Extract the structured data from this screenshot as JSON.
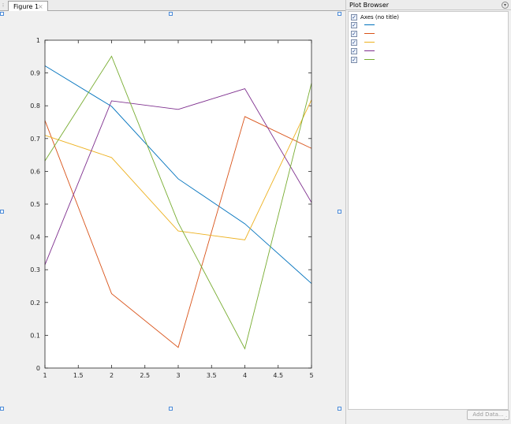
{
  "tabs": {
    "handle_glyph": "⁝",
    "figure_label": "Figure 1",
    "close_glyph": "×"
  },
  "plot_browser": {
    "title": "Plot Browser",
    "menu_glyph": "▾",
    "axes_label": "Axes (no title)",
    "check_glyph": "✓",
    "add_data_label": "Add Data...",
    "grip_glyph": "⋰"
  },
  "colors": {
    "series": [
      "#0072bd",
      "#d95319",
      "#edb120",
      "#7e2f8e",
      "#77ac30"
    ]
  },
  "chart_data": {
    "type": "line",
    "x": [
      1,
      2,
      3,
      4,
      5
    ],
    "series": [
      {
        "values": [
          0.922,
          0.798,
          0.577,
          0.44,
          0.258
        ]
      },
      {
        "values": [
          0.755,
          0.227,
          0.063,
          0.767,
          0.67
        ]
      },
      {
        "values": [
          0.71,
          0.642,
          0.418,
          0.391,
          0.818
        ]
      },
      {
        "values": [
          0.315,
          0.815,
          0.789,
          0.852,
          0.505
        ]
      },
      {
        "values": [
          0.632,
          0.951,
          0.443,
          0.059,
          0.869
        ]
      }
    ],
    "xlim": [
      1,
      5
    ],
    "ylim": [
      0,
      1
    ],
    "xticks": [
      "1",
      "1.5",
      "2",
      "2.5",
      "3",
      "3.5",
      "4",
      "4.5",
      "5"
    ],
    "yticks": [
      "0",
      "0.1",
      "0.2",
      "0.3",
      "0.4",
      "0.5",
      "0.6",
      "0.7",
      "0.8",
      "0.9",
      "1"
    ],
    "grid": false,
    "legend": "none"
  }
}
